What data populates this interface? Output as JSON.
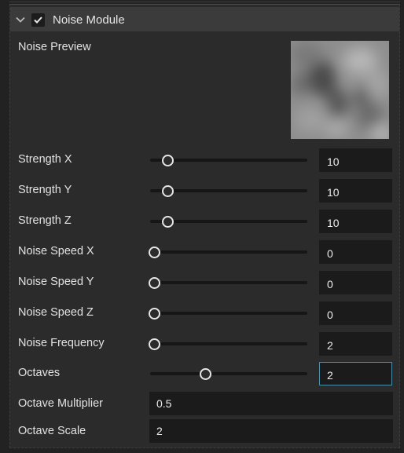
{
  "module": {
    "title": "Noise Module",
    "enabled": true,
    "preview_label": "Noise Preview"
  },
  "sliders": [
    {
      "label": "Strength X",
      "value": "10",
      "level": 0.11
    },
    {
      "label": "Strength Y",
      "value": "10",
      "level": 0.11
    },
    {
      "label": "Strength Z",
      "value": "10",
      "level": 0.11
    },
    {
      "label": "Noise Speed X",
      "value": "0",
      "level": 0.0
    },
    {
      "label": "Noise Speed Y",
      "value": "0",
      "level": 0.0
    },
    {
      "label": "Noise Speed Z",
      "value": "0",
      "level": 0.0
    },
    {
      "label": "Noise Frequency",
      "value": "2",
      "level": 0.02
    },
    {
      "label": "Octaves",
      "value": "2",
      "level": 0.35
    }
  ],
  "fields": [
    {
      "label": "Octave Multiplier",
      "value": "0.5"
    },
    {
      "label": "Octave Scale",
      "value": "2"
    }
  ],
  "colors": {
    "background": "#222222",
    "panel": "#2b2b2b",
    "header": "#3b3b3b",
    "field": "#1b1b1b",
    "focus_border": "#4d8fa8"
  },
  "icons": {
    "collapse": "chevron-down-icon",
    "enabled": "checkmark-icon"
  }
}
